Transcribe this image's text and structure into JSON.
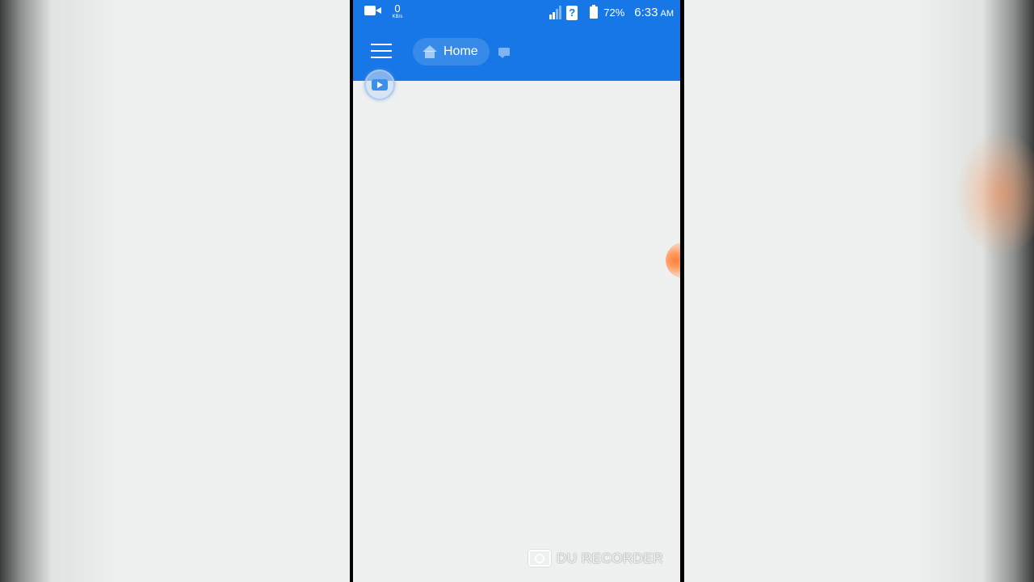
{
  "status_bar": {
    "net_speed_value": "0",
    "net_speed_unit": "KB/s",
    "battery_percent": "72%",
    "time": "6:33",
    "ampm": "AM",
    "help_symbol": "?",
    "icons": [
      "video-camera-icon",
      "signal-icon",
      "help-icon",
      "battery-icon"
    ]
  },
  "app_bar": {
    "home_label": "Home",
    "icons": [
      "menu-icon",
      "home-icon",
      "chat-icon"
    ],
    "accent_color": "#1877e6"
  },
  "floating": {
    "icons": [
      "play-icon",
      "recorder-bubble-icon"
    ]
  },
  "watermark": {
    "text": "DU RECORDER",
    "icon": "camera-icon"
  }
}
